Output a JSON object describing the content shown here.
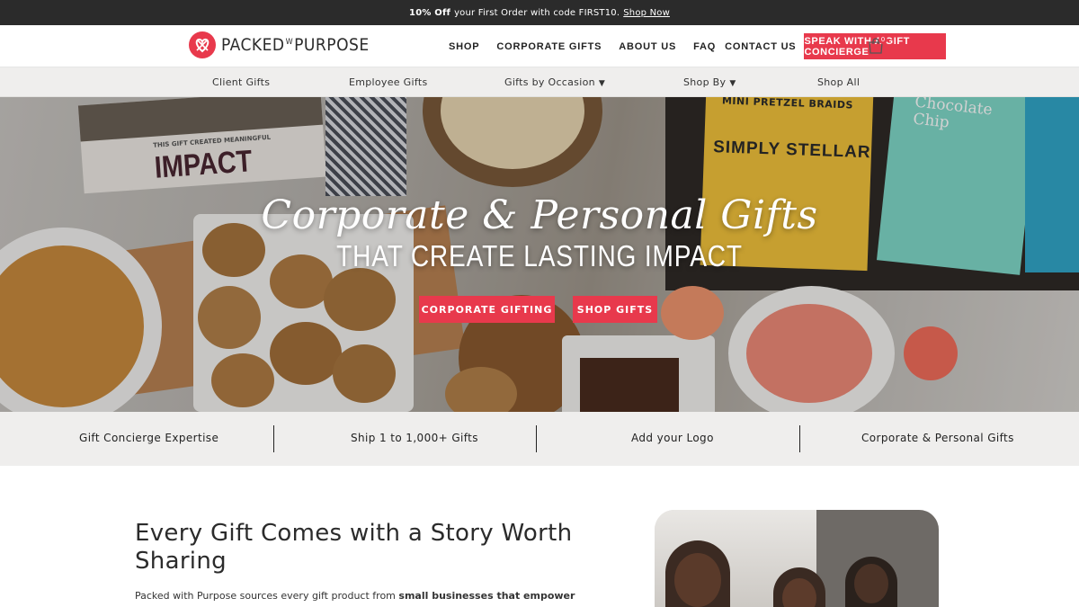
{
  "announcement": {
    "bold": "10% Off",
    "text": "your First Order with code FIRST10.",
    "link": "Shop Now"
  },
  "header": {
    "logo_left": "PACKED",
    "logo_w": "W",
    "logo_right": "PURPOSE",
    "nav": [
      "SHOP",
      "CORPORATE GIFTS",
      "ABOUT US",
      "FAQ",
      "CONTACT US"
    ],
    "cta": "SPEAK WITH A GIFT CONCIERGE",
    "cart_count": "0"
  },
  "subnav": [
    "Client Gifts",
    "Employee Gifts",
    "Gifts by Occasion",
    "Shop By",
    "Shop All"
  ],
  "hero": {
    "script": "Corporate & Personal Gifts",
    "subtitle": "THAT CREATE LASTING IMPACT",
    "btn_corporate": "CORPORATE GIFTING",
    "btn_shop": "SHOP GIFTS",
    "card_small": "THIS GIFT CREATED MEANINGFUL",
    "card_big": "IMPACT",
    "bag1_top": "MINI PRETZEL BRAIDS",
    "bag1_brand": "SIMPLY STELLAR",
    "bag2_top": "Chocolate Chip"
  },
  "features": [
    "Gift Concierge Expertise",
    "Ship 1 to 1,000+ Gifts",
    "Add your Logo",
    "Corporate & Personal Gifts"
  ],
  "story": {
    "title": "Every Gift Comes with a Story Worth Sharing",
    "text_prefix": "Packed with Purpose sources every gift product from ",
    "text_bold": "small businesses that empower U.S."
  },
  "colors": {
    "accent": "#e8394c",
    "dark": "#2b2b2b",
    "light_bg": "#efeeed"
  }
}
